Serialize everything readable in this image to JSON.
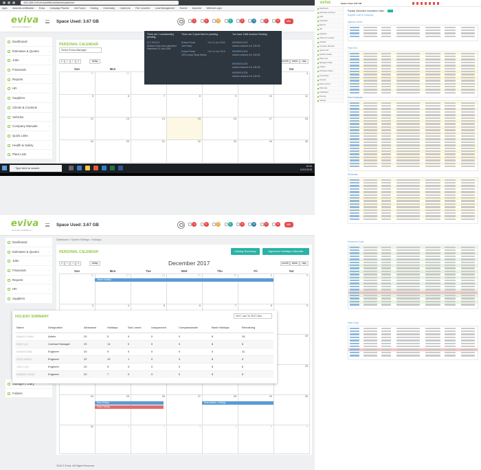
{
  "browser": {
    "url": "192.168.0.61/eviva/#/timesheets/calendar",
    "bookmarks": [
      "Apps",
      "Adwords certification",
      "Eviva",
      "Campaign Planner",
      "Get Found",
      "Hosting",
      "Grammarly",
      "CyberLink",
      "File Converter",
      "Lead Management",
      "Scored",
      "Imported",
      "Webmail Login"
    ]
  },
  "header": {
    "logo": "eviva",
    "logo_sub": "electrical installations",
    "space_used": "Space Used: 3.67 GB",
    "badges": [
      "1",
      "0",
      "0",
      "2",
      "4",
      "0",
      "0",
      "0",
      "0"
    ],
    "user_pill": "MM"
  },
  "sidebar": {
    "items": [
      {
        "label": "Dashboard"
      },
      {
        "label": "Estimates & Quotes"
      },
      {
        "label": "Jobs"
      },
      {
        "label": "Financials"
      },
      {
        "label": "Reports"
      },
      {
        "label": "HR"
      },
      {
        "label": "Suppliers"
      },
      {
        "label": "Clients & Contacts"
      },
      {
        "label": "Vehicles"
      },
      {
        "label": "Company Manuals"
      },
      {
        "label": "Quick Links"
      },
      {
        "label": "Health & Safety"
      },
      {
        "label": "Plant Lists"
      }
    ],
    "bottom_items": [
      {
        "label": "Manager's Diary"
      },
      {
        "label": "Folders"
      }
    ]
  },
  "calendar_top": {
    "title": "PERSONAL CALENDAR",
    "select_value": "Select Eviva Manager",
    "today_label": "today",
    "view_buttons": [
      "month",
      "week",
      "day"
    ],
    "weekday_headers": [
      "Sun",
      "Mon",
      "Tue",
      "Wed",
      "Thu",
      "Fri",
      "Sat"
    ],
    "rows": [
      [
        "29",
        "30",
        "31",
        "1",
        "2",
        "3",
        "4"
      ],
      [
        "5",
        "6",
        "7",
        "8",
        "9",
        "10",
        "11"
      ],
      [
        "12",
        "13",
        "14",
        "15",
        "16",
        "17",
        "18"
      ],
      [
        "19",
        "20",
        "21",
        "22",
        "23",
        "24",
        "25"
      ]
    ]
  },
  "popover": {
    "col1_head": "There are 1 worksheet(s) pending",
    "col1_link": "Q-T-001314",
    "col1_text": "Andrew Dean has submitted timesheet 11-Jan-2018",
    "col2_head": "There are 3 plant hired re-pending",
    "col2_items": [
      {
        "title": "Extract Panel",
        "date": "Tue 11-Jan-2018"
      },
      {
        "title": "Extract Panel",
        "date": "Tue 10-Jan-2018"
      }
    ],
    "col2_text": [
      "Joe Pump",
      "CEO Lamp Flood Works"
    ],
    "col3_head": "You have 1168 Invoices Pending",
    "col3_items": [
      {
        "title": "INV000011223",
        "text": "Invoice amount is £ 130.00"
      },
      {
        "title": "INV000011224",
        "text": "Invoice amount is £ 130.00"
      },
      {
        "title": "INV000011225",
        "text": "Invoice amount is £ 130.00"
      },
      {
        "title": "INV000011226",
        "text": "Invoice amount is £ 130.00"
      }
    ]
  },
  "taskbar": {
    "search_placeholder": "Type here to search",
    "time": "16:06",
    "date": "11/01/2018"
  },
  "calendar_bottom": {
    "breadcrumb": "Dashboard > System Settings > Holidays",
    "title": "PERSONAL CALENDAR",
    "holiday_summary_btn": "Holiday Summary",
    "approved_btn": "Approved Holidays Calendar",
    "month_title": "December 2017",
    "today_label": "today",
    "view_buttons": [
      "month",
      "week",
      "day"
    ],
    "weekday_headers": [
      "Sun",
      "Mon",
      "Tue",
      "Wed",
      "Thu",
      "Fri",
      "Sat"
    ],
    "week1": [
      "26",
      "27",
      "28",
      "29",
      "30",
      "1",
      "2"
    ],
    "week2": [
      "3",
      "4",
      "5",
      "6",
      "7",
      "8",
      "9"
    ],
    "row_right_nums": [
      "16",
      "23",
      "30"
    ],
    "week_late": [
      "24",
      "25",
      "26",
      "27",
      "28",
      "29",
      "30"
    ],
    "week_last": [
      "31",
      "1",
      "2",
      "3",
      "4",
      "5",
      "6"
    ],
    "events": [
      {
        "label": "Janice Holiday"
      },
      {
        "label": "Nick Holiday"
      },
      {
        "label": "Sean Holiday"
      },
      {
        "label": "Sean Adkins - Holiday"
      }
    ]
  },
  "holiday_summary": {
    "title": "HOLIDAY SUMMARY",
    "range_select": "2017-Jan To 2017-Dec",
    "columns": [
      "Name",
      "Designation",
      "Allowance",
      "Holidays",
      "Sick Leave",
      "Unapproved",
      "Compassionate",
      "Bank Holidays",
      "Remaining"
    ],
    "rows": [
      [
        "Wayne Fowler",
        "Admin",
        "20",
        "5",
        "0",
        "0",
        "0",
        "8",
        "15"
      ],
      [
        "Mark Lee",
        "Contract Manager",
        "20",
        "14",
        "0",
        "0",
        "0",
        "8",
        "6"
      ],
      [
        "Andrew Dale",
        "Engineer",
        "20",
        "9",
        "0",
        "0",
        "0",
        "3",
        "11"
      ],
      [
        "Sean Adkins",
        "Engineer",
        "22",
        "13",
        "1",
        "0",
        "0",
        "8",
        "9"
      ],
      [
        "John Lord",
        "Engineer",
        "20",
        "5",
        "0",
        "0",
        "0",
        "8",
        "6"
      ],
      [
        "Matthew Smith",
        "Engineer",
        "20",
        "7",
        "0",
        "0",
        "0",
        "8",
        "6"
      ]
    ]
  },
  "footer": {
    "text": "2018 © Eviva. All Rights Reserved."
  },
  "right_panel": {
    "space_used": "Space Used: 3.67 GB",
    "page_title": "Payslip Generator Innovation Video",
    "sections": [
      "Supplier Cost to Company",
      "Agency Labour",
      "Plant Hire",
      "Sub-Contractor",
      "Wholesale",
      "Personnel Costs",
      "Fleet Costs"
    ],
    "side_items": [
      "Dashboard",
      "Estimates & Quotes",
      "Jobs",
      "Financials",
      "Reports",
      "HR",
      "Suppliers",
      "Clients & Contacts",
      "Vehicles",
      "Company Manuals",
      "Quick Links",
      "Health & Safety",
      "Plant Lists",
      "Manager's Diary",
      "Folders",
      "Purchase Orders",
      "Timesheets",
      "Invoices",
      "Stock Control",
      "Plant Hire",
      "Certificates",
      "Training",
      "Settings"
    ]
  },
  "colors": {
    "brand_green": "#8cc63f",
    "teal": "#2ab2a6",
    "badge_red": "#e44d4d",
    "event_blue": "#5b9bd5",
    "event_red": "#e46a6a",
    "popover_bg": "#2e3640"
  }
}
